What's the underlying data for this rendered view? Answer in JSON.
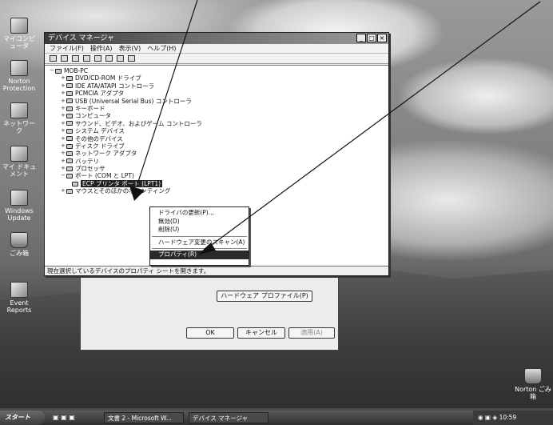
{
  "desktop": {
    "icons": [
      {
        "label": "マイコンピュータ",
        "name": "my-computer"
      },
      {
        "label": "Norton Protection",
        "name": "norton"
      },
      {
        "label": "ネットワーク",
        "name": "network"
      },
      {
        "label": "マイ ドキュメント",
        "name": "my-documents"
      },
      {
        "label": "Windows Update",
        "name": "windows-update"
      },
      {
        "label": "ごみ箱",
        "name": "recycle-bin"
      },
      {
        "label": "Event Reports",
        "name": "event-reports"
      }
    ],
    "corner_icon_label": "Norton ごみ箱"
  },
  "window": {
    "title": "デバイス マネージャ",
    "menus": [
      "ファイル(F)",
      "操作(A)",
      "表示(V)",
      "ヘルプ(H)"
    ],
    "root": "MOB-PC",
    "tree": [
      {
        "label": "DVD/CD-ROM ドライブ"
      },
      {
        "label": "IDE ATA/ATAPI コントローラ"
      },
      {
        "label": "PCMCIA アダプタ"
      },
      {
        "label": "USB (Universal Serial Bus) コントローラ"
      },
      {
        "label": "キーボード"
      },
      {
        "label": "コンピュータ"
      },
      {
        "label": "サウンド、ビデオ、およびゲーム コントローラ"
      },
      {
        "label": "システム デバイス"
      },
      {
        "label": "その他のデバイス"
      },
      {
        "label": "ディスク ドライブ"
      },
      {
        "label": "ネットワーク アダプタ"
      },
      {
        "label": "バッテリ"
      },
      {
        "label": "プロセッサ"
      },
      {
        "label": "ポート (COM と LPT)"
      }
    ],
    "selected_child": "ECP プリンタ ポート (LPT1)",
    "after": "マウスとそのほかのポインティング",
    "status": "現在選択しているデバイスのプロパティ シートを開きます。"
  },
  "context_menu": {
    "items": [
      "ドライバの更新(P)...",
      "無効(D)",
      "削除(U)",
      "ハードウェア変更のスキャン(A)",
      "プロパティ(R)"
    ],
    "highlighted_index": 4
  },
  "props_dialog": {
    "hw_profile_button": "ハードウェア プロファイル(P)",
    "ok": "OK",
    "cancel": "キャンセル",
    "apply": "適用(A)"
  },
  "taskbar": {
    "start": "スタート",
    "tasks": [
      "文書 2 - Microsoft W...",
      "デバイス マネージャ"
    ],
    "clock": "10:59"
  }
}
